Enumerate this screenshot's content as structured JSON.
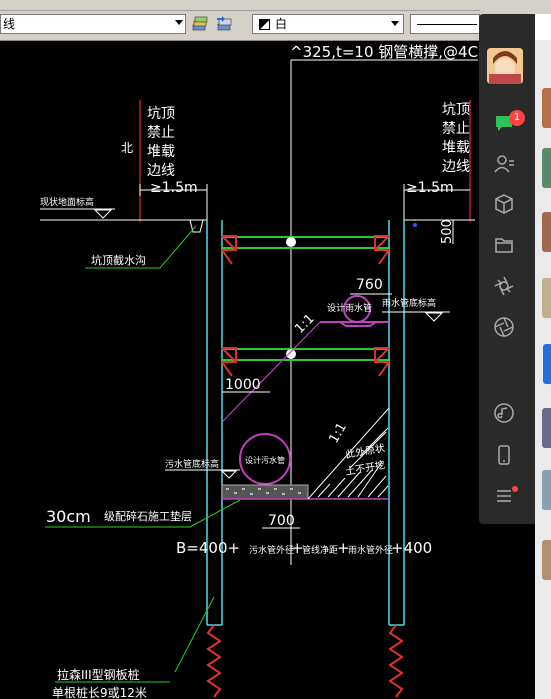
{
  "toolbar": {
    "layer_value": "线",
    "color_value": "白"
  },
  "drawing": {
    "top_label": "^325,t=10 钢管横撑,@4C",
    "pit_top_left": [
      "坑顶",
      "禁止",
      "堆载",
      "边线"
    ],
    "pit_top_right": [
      "坑顶",
      "禁止",
      "堆载",
      "边线"
    ],
    "north": "北",
    "left_dim": "≥1.5m",
    "right_dim": "≥1.5m",
    "ground_level": "现状地面标高",
    "drain_ditch": "坑顶截水沟",
    "dim_500": "500",
    "dim_760": "760",
    "rain_pipe_design": "设计雨水管",
    "rain_pipe_bottom": "雨水管底标高",
    "slope_upper": "1:1",
    "dim_1000": "1000",
    "sewage_pipe_design": "设计污水管",
    "sewage_pipe_bottom": "污水管底标高",
    "slope_lower": "1:1",
    "backfill": [
      "此外原状",
      "土不开挖"
    ],
    "gravel_cushion_size": "30cm",
    "gravel_cushion_label": "级配碎石施工垫层",
    "dim_700": "700",
    "width_formula_lead": "B=400+",
    "width_formula_part1": "污水管外径",
    "width_formula_plus1": "+",
    "width_formula_part2": "管线净距",
    "width_formula_plus2": "+",
    "width_formula_part3": "雨水管外径",
    "width_formula_tail": "+400",
    "sheet_pile_1": "拉森III型钢板桩",
    "sheet_pile_2": "单根桩长9或12米"
  },
  "side_panel": {
    "chat_badge": "1"
  },
  "colors": {
    "pile": "#5ad7e6",
    "strut": "#2ec82e",
    "bracket": "#e03030",
    "text": "#ffffff",
    "pipe": "#c040c0",
    "leader": "#1fd11f"
  }
}
